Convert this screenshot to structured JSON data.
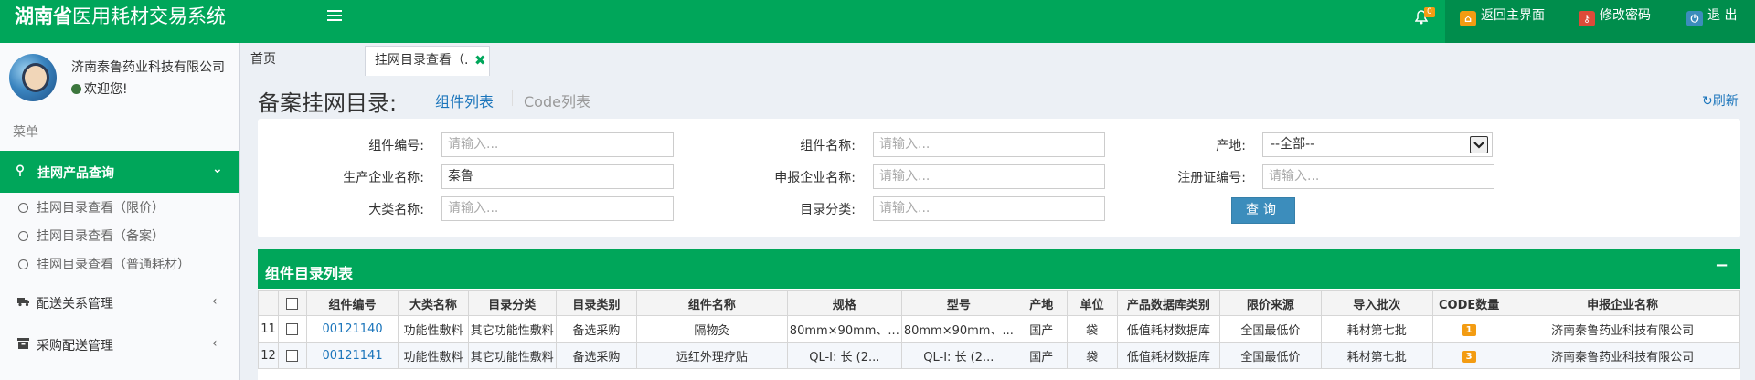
{
  "app": {
    "title_bold": "湖南省",
    "title_rest": "医用耗材交易系统",
    "notification_count": "0"
  },
  "header_nav": [
    {
      "label": "返回主界面",
      "icon": "home-icon",
      "color": "#f39c12"
    },
    {
      "label": "修改密码",
      "icon": "key-icon",
      "color": "#dd4b39"
    },
    {
      "label": "退 出",
      "icon": "power-icon",
      "color": "#3c8dbc"
    }
  ],
  "user": {
    "name": "济南秦鲁药业科技有限公司",
    "status": "欢迎您!"
  },
  "sidebar": {
    "header": "菜单",
    "active_item": "挂网产品查询",
    "sub_items": [
      "挂网目录查看（限价）",
      "挂网目录查看（备案）",
      "挂网目录查看（普通耗材）"
    ],
    "items": [
      "配送关系管理",
      "采购配送管理"
    ]
  },
  "tabs": {
    "home": "首页",
    "active": "挂网目录查看（."
  },
  "main": {
    "title": "备案挂网目录:",
    "sub_tabs": [
      "组件列表",
      "Code列表"
    ],
    "refresh": "刷新"
  },
  "filters": {
    "component_code": {
      "label": "组件编号:",
      "placeholder": "请输入..."
    },
    "component_name": {
      "label": "组件名称:",
      "placeholder": "请输入..."
    },
    "origin": {
      "label": "产地:",
      "value": "--全部--"
    },
    "manufacturer": {
      "label": "生产企业名称:",
      "value": "秦鲁"
    },
    "applicant": {
      "label": "申报企业名称:",
      "placeholder": "请输入..."
    },
    "reg_cert": {
      "label": "注册证编号:",
      "placeholder": "请输入..."
    },
    "category": {
      "label": "大类名称:",
      "placeholder": "请输入..."
    },
    "catalog_class": {
      "label": "目录分类:",
      "placeholder": "请输入..."
    },
    "query_button": "查询"
  },
  "list": {
    "title": "组件目录列表",
    "collapse": "−",
    "columns": [
      "",
      "",
      "组件编号",
      "大类名称",
      "目录分类",
      "目录类别",
      "组件名称",
      "规格",
      "型号",
      "产地",
      "单位",
      "产品数据库类别",
      "限价来源",
      "导入批次",
      "CODE数量",
      "申报企业名称"
    ],
    "rows": [
      {
        "idx": "11",
        "code": "00121140",
        "category": "功能性敷料",
        "catalog_class": "其它功能性敷料",
        "catalog_type": "备选采购",
        "name": "隔物灸",
        "spec": "80mm×90mm、...",
        "model": "80mm×90mm、...",
        "origin": "国产",
        "unit": "袋",
        "db_type": "低值耗材数据库",
        "price_source": "全国最低价",
        "batch": "耗材第七批",
        "code_count": "1",
        "applicant": "济南秦鲁药业科技有限公司"
      },
      {
        "idx": "12",
        "code": "00121141",
        "category": "功能性敷料",
        "catalog_class": "其它功能性敷料",
        "catalog_type": "备选采购",
        "name": "远红外理疗贴",
        "spec": "QL-I: 长 (2...",
        "model": "QL-I: 长 (2...",
        "origin": "国产",
        "unit": "袋",
        "db_type": "低值耗材数据库",
        "price_source": "全国最低价",
        "batch": "耗材第七批",
        "code_count": "3",
        "applicant": "济南秦鲁药业科技有限公司"
      }
    ]
  },
  "colors": {
    "brand": "#00a65a",
    "brand_dark": "#008d4c",
    "link": "#1b75bb",
    "badge": "#f39c12"
  }
}
